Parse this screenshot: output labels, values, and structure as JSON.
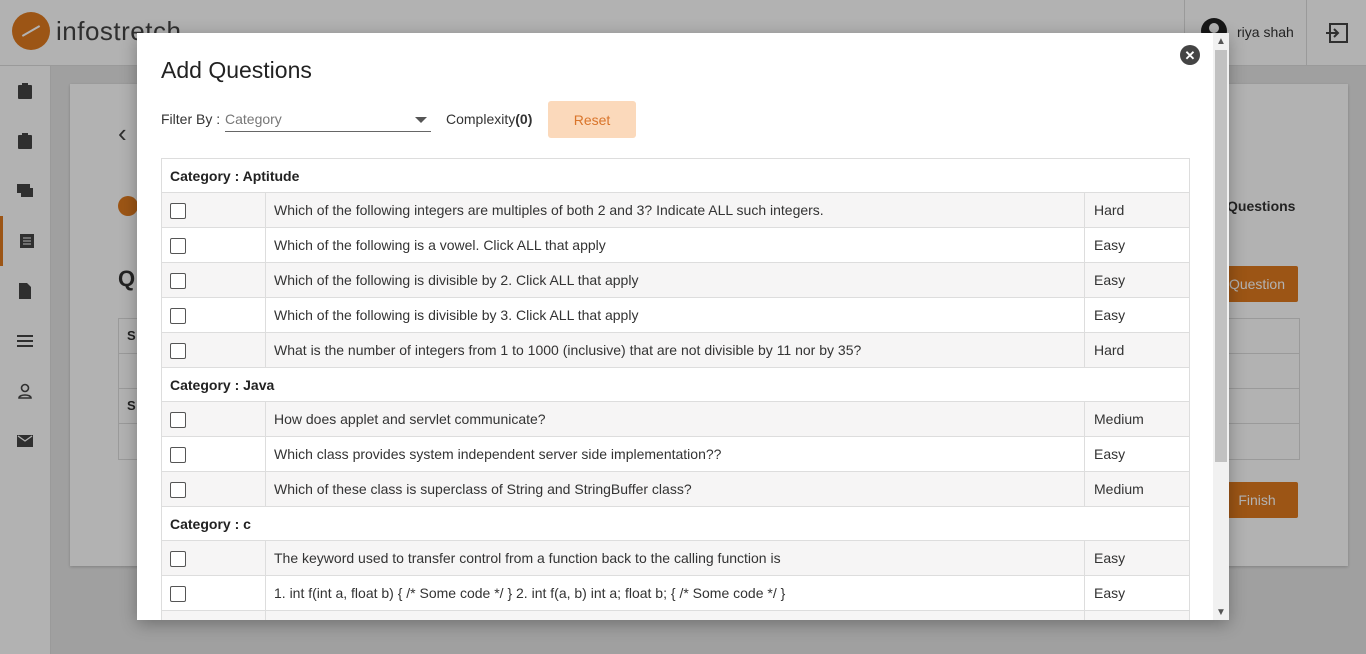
{
  "app": {
    "brand": "infostretch",
    "user_name": "riya shah"
  },
  "background": {
    "questions_heading": "Questions",
    "big_letter": "Q",
    "add_question_button": "Question",
    "finish_button": "Finish",
    "table_rows": [
      "S",
      "",
      "S",
      ""
    ]
  },
  "modal": {
    "title": "Add Questions",
    "filter_label": "Filter By :",
    "filter_placeholder": "Category",
    "complexity_label": "Complexity",
    "complexity_count": "(0)",
    "reset_label": "Reset",
    "close_glyph": "✕",
    "categories": [
      {
        "label": "Category : Aptitude",
        "questions": [
          {
            "text": "Which of the following integers are multiples of both 2 and 3? Indicate ALL such integers.",
            "complexity": "Hard"
          },
          {
            "text": "Which of the following is a vowel. Click ALL that apply",
            "complexity": "Easy"
          },
          {
            "text": "Which of the following is divisible by 2. Click ALL that apply",
            "complexity": "Easy"
          },
          {
            "text": "Which of the following is divisible by 3. Click ALL that apply",
            "complexity": "Easy"
          },
          {
            "text": "What is the number of integers from 1 to 1000 (inclusive) that are not divisible by 11 nor by 35?",
            "complexity": "Hard"
          }
        ]
      },
      {
        "label": "Category : Java",
        "questions": [
          {
            "text": "How does applet and servlet communicate?",
            "complexity": "Medium"
          },
          {
            "text": "Which class provides system independent server side implementation??",
            "complexity": "Easy"
          },
          {
            "text": "Which of these class is superclass of String and StringBuffer class?",
            "complexity": "Medium"
          }
        ]
      },
      {
        "label": "Category : c",
        "questions": [
          {
            "text": "The keyword used to transfer control from a function back to the calling function is",
            "complexity": "Easy"
          },
          {
            "text": "1. int f(int a, float b) { /* Some code */ } 2. int f(a, b) int a; float b; { /* Some code */ }",
            "complexity": "Easy"
          },
          {
            "text": "",
            "complexity": ""
          }
        ]
      }
    ]
  },
  "colors": {
    "accent": "#e07a1f",
    "reset_bg": "#fbd9bb"
  }
}
